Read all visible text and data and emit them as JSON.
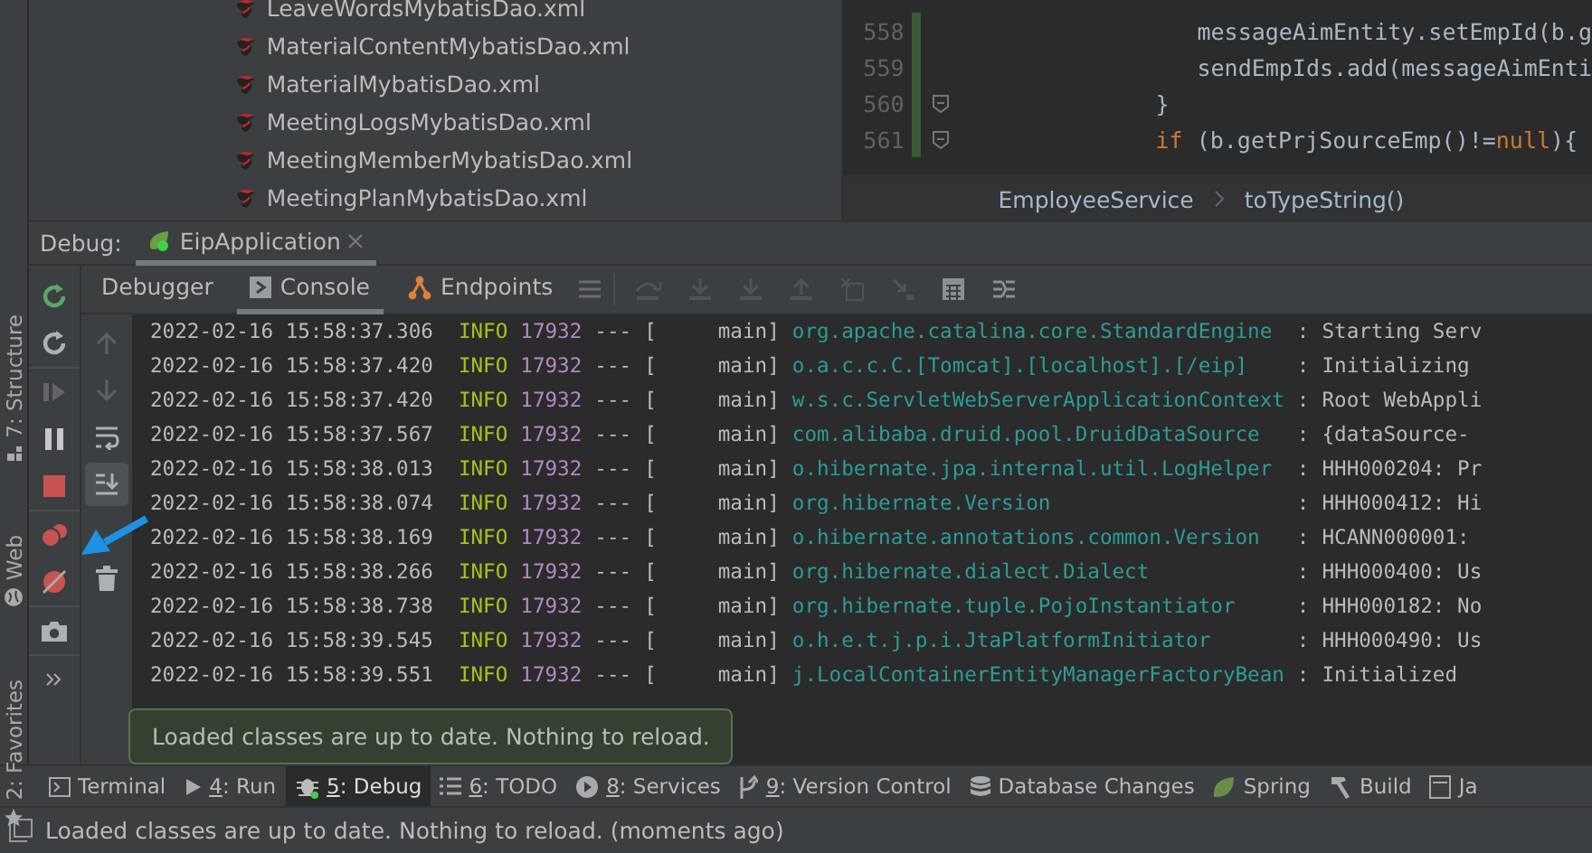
{
  "project_tree": {
    "items": [
      {
        "label": "LeaveWordsMybatisDao.xml",
        "selected": false
      },
      {
        "label": "MaterialContentMybatisDao.xml",
        "selected": false
      },
      {
        "label": "MaterialMybatisDao.xml",
        "selected": false
      },
      {
        "label": "MeetingLogsMybatisDao.xml",
        "selected": false
      },
      {
        "label": "MeetingMemberMybatisDao.xml",
        "selected": false
      },
      {
        "label": "MeetingPlanMybatisDao.xml",
        "selected": false
      }
    ]
  },
  "editor": {
    "lines": [
      {
        "number": "558",
        "kind": "inner",
        "fold": false,
        "tokens": [
          {
            "text": "messageAimEntity.setEmpId(b.g",
            "kind": "plain"
          }
        ]
      },
      {
        "number": "559",
        "kind": "inner",
        "fold": false,
        "tokens": [
          {
            "text": "sendEmpIds.add(messageAimEnti",
            "kind": "plain"
          }
        ]
      },
      {
        "number": "560",
        "kind": "outer",
        "fold": true,
        "tokens": [
          {
            "text": "}",
            "kind": "plain"
          }
        ]
      },
      {
        "number": "561",
        "kind": "outer",
        "fold": true,
        "tokens": [
          {
            "text": "if",
            "kind": "keyword"
          },
          {
            "text": " (b.getPrjSourceEmp()!=",
            "kind": "plain"
          },
          {
            "text": "null",
            "kind": "keyword"
          },
          {
            "text": "){",
            "kind": "plain"
          }
        ]
      }
    ],
    "breadcrumbs": [
      "EmployeeService",
      "toTypeString()"
    ]
  },
  "side_tool_windows": [
    {
      "label": "7: Structure",
      "kind": "structure"
    },
    {
      "label": "Web",
      "kind": "web"
    },
    {
      "label": "2: Favorites",
      "kind": "favorites"
    }
  ],
  "debug": {
    "title": "Debug:",
    "sessions": [
      {
        "label": "EipApplication",
        "selected": true
      }
    ],
    "tabs": [
      {
        "label": "Debugger",
        "kind": "debugger",
        "selected": false
      },
      {
        "label": "Console",
        "kind": "console",
        "selected": true
      },
      {
        "label": "Endpoints",
        "kind": "endpoints",
        "selected": false
      }
    ],
    "step_toolbar": [
      {
        "kind": "step-over",
        "disabled": true
      },
      {
        "kind": "step-into",
        "disabled": true
      },
      {
        "kind": "force-step-into",
        "disabled": true
      },
      {
        "kind": "step-out",
        "disabled": true
      },
      {
        "kind": "drop-frame",
        "disabled": true
      },
      {
        "kind": "run-to-cursor",
        "disabled": true
      },
      {
        "kind": "evaluate",
        "disabled": false
      },
      {
        "kind": "trace",
        "disabled": false
      }
    ],
    "side_toolbar": [
      {
        "kind": "rerun-green",
        "disabled": false
      },
      {
        "kind": "rerun",
        "disabled": false
      },
      {
        "kind": "resume",
        "disabled": true
      },
      {
        "kind": "pause",
        "disabled": false
      },
      {
        "kind": "stop",
        "disabled": false
      },
      {
        "kind": "breakpoints",
        "disabled": false
      },
      {
        "kind": "mute",
        "disabled": false
      },
      {
        "kind": "camera",
        "disabled": false
      },
      {
        "kind": "more",
        "disabled": false
      }
    ],
    "console_toolbar": [
      {
        "kind": "up",
        "selected": false,
        "disabled": true
      },
      {
        "kind": "down",
        "selected": false,
        "disabled": true
      },
      {
        "kind": "wrap",
        "selected": false,
        "disabled": false
      },
      {
        "kind": "scroll-end",
        "selected": true,
        "disabled": false
      },
      {
        "kind": "trash",
        "selected": false,
        "disabled": false
      }
    ],
    "console_lines": [
      {
        "time": "2022-02-16 15:58:37.306",
        "level": "INFO",
        "pid": "17932",
        "dashes": "---",
        "thread": "[     main]",
        "logger": "org.apache.catalina.core.StandardEngine",
        "sep": ":",
        "message": "Starting Serv"
      },
      {
        "time": "2022-02-16 15:58:37.420",
        "level": "INFO",
        "pid": "17932",
        "dashes": "---",
        "thread": "[     main]",
        "logger": "o.a.c.c.C.[Tomcat].[localhost].[/eip]",
        "sep": ":",
        "message": "Initializing"
      },
      {
        "time": "2022-02-16 15:58:37.420",
        "level": "INFO",
        "pid": "17932",
        "dashes": "---",
        "thread": "[     main]",
        "logger": "w.s.c.ServletWebServerApplicationContext",
        "sep": ":",
        "message": "Root WebAppli"
      },
      {
        "time": "2022-02-16 15:58:37.567",
        "level": "INFO",
        "pid": "17932",
        "dashes": "---",
        "thread": "[     main]",
        "logger": "com.alibaba.druid.pool.DruidDataSource",
        "sep": ":",
        "message": "{dataSource-"
      },
      {
        "time": "2022-02-16 15:58:38.013",
        "level": "INFO",
        "pid": "17932",
        "dashes": "---",
        "thread": "[     main]",
        "logger": "o.hibernate.jpa.internal.util.LogHelper",
        "sep": ":",
        "message": "HHH000204: Pr"
      },
      {
        "time": "2022-02-16 15:58:38.074",
        "level": "INFO",
        "pid": "17932",
        "dashes": "---",
        "thread": "[     main]",
        "logger": "org.hibernate.Version",
        "sep": ":",
        "message": "HHH000412: Hi"
      },
      {
        "time": "2022-02-16 15:58:38.169",
        "level": "INFO",
        "pid": "17932",
        "dashes": "---",
        "thread": "[     main]",
        "logger": "o.hibernate.annotations.common.Version",
        "sep": ":",
        "message": "HCANN000001:"
      },
      {
        "time": "2022-02-16 15:58:38.266",
        "level": "INFO",
        "pid": "17932",
        "dashes": "---",
        "thread": "[     main]",
        "logger": "org.hibernate.dialect.Dialect",
        "sep": ":",
        "message": "HHH000400: Us"
      },
      {
        "time": "2022-02-16 15:58:38.738",
        "level": "INFO",
        "pid": "17932",
        "dashes": "---",
        "thread": "[     main]",
        "logger": "org.hibernate.tuple.PojoInstantiator",
        "sep": ":",
        "message": "HHH000182: No"
      },
      {
        "time": "2022-02-16 15:58:39.545",
        "level": "INFO",
        "pid": "17932",
        "dashes": "---",
        "thread": "[     main]",
        "logger": "o.h.e.t.j.p.i.JtaPlatformInitiator",
        "sep": ":",
        "message": "HHH000490: Us"
      },
      {
        "time": "2022-02-16 15:58:39.551",
        "level": "INFO",
        "pid": "17932",
        "dashes": "---",
        "thread": "[     main]",
        "logger": "j.LocalContainerEntityManagerFactoryBean",
        "sep": ":",
        "message": "Initialized"
      }
    ],
    "tooltip": "Loaded classes are up to date. Nothing to reload."
  },
  "tool_windows": [
    {
      "label": "Terminal",
      "kind": "terminal",
      "selected": false
    },
    {
      "label": "4: Run",
      "kind": "run",
      "selected": false
    },
    {
      "label": "5: Debug",
      "kind": "debug",
      "selected": true
    },
    {
      "label": "6: TODO",
      "kind": "todo",
      "selected": false
    },
    {
      "label": "8: Services",
      "kind": "services",
      "selected": false
    },
    {
      "label": "9: Version Control",
      "kind": "vcs",
      "selected": false
    },
    {
      "label": "Database Changes",
      "kind": "database",
      "selected": false
    },
    {
      "label": "Spring",
      "kind": "spring",
      "selected": false
    },
    {
      "label": "Build",
      "kind": "build",
      "selected": false
    },
    {
      "label": "Ja",
      "kind": "java",
      "selected": false
    }
  ],
  "status_bar": {
    "message": "Loaded classes are up to date. Nothing to reload. (moments ago)"
  }
}
